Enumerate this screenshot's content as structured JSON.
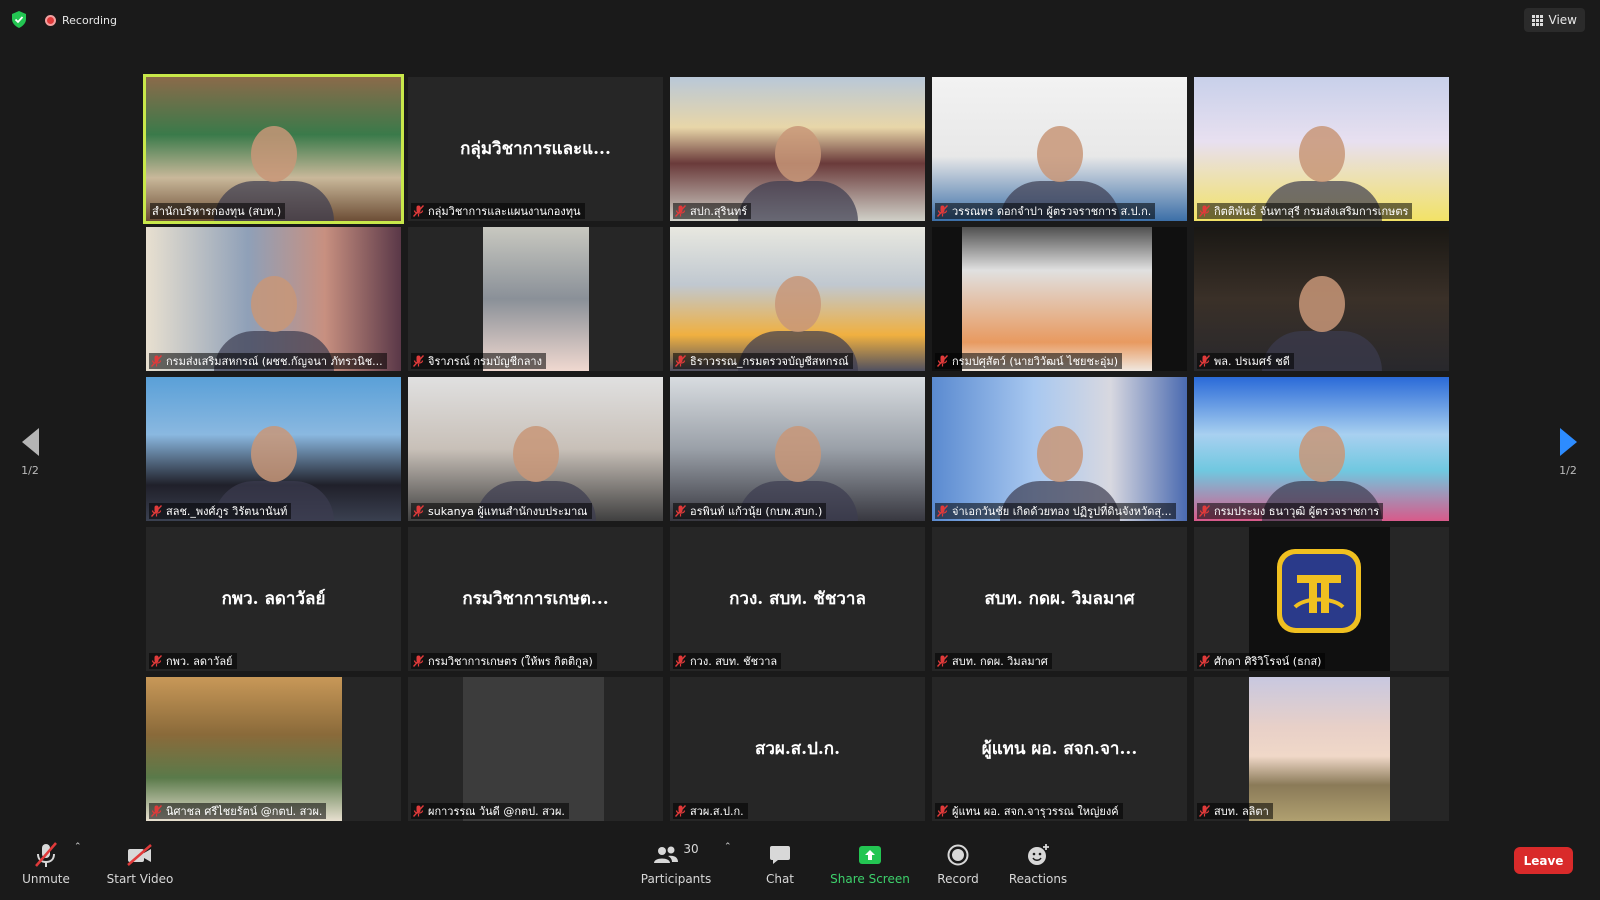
{
  "recording": {
    "label": "Recording"
  },
  "view_button": {
    "label": "View"
  },
  "pager": {
    "left_label": "1/2",
    "right_label": "1/2"
  },
  "tiles": [
    {
      "label": "สำนักบริหารกองทุน (สบท.)",
      "muted": false,
      "video": true,
      "center_name": ""
    },
    {
      "label": "กลุ่มวิชาการและแผนงานกองทุน",
      "muted": true,
      "video": false,
      "center_name": "กลุ่มวิชาการและแ..."
    },
    {
      "label": "สปก.สุรินทร์",
      "muted": true,
      "video": true,
      "center_name": ""
    },
    {
      "label": "วรรณพร ดอกจำปา ผู้ตรวจราชการ ส.ป.ก.",
      "muted": true,
      "video": true,
      "center_name": ""
    },
    {
      "label": "กิตติพันธ์ จันทาสุรี กรมส่งเสริมการเกษตร",
      "muted": true,
      "video": true,
      "center_name": ""
    },
    {
      "label": "กรมส่งเสริมสหกรณ์ (ผชช.กัญจนา ภัทรวนิช...",
      "muted": true,
      "video": true,
      "center_name": ""
    },
    {
      "label": "จิราภรณ์ กรมบัญชีกลาง",
      "muted": true,
      "video": true,
      "center_name": ""
    },
    {
      "label": "ธิราวรรณ_กรมตรวจบัญชีสหกรณ์",
      "muted": true,
      "video": true,
      "center_name": ""
    },
    {
      "label": "กรมปศุสัตว์ (นายวิวัฒน์ ไชยชะอุ่ม)",
      "muted": true,
      "video": true,
      "center_name": ""
    },
    {
      "label": "พล. ปรเมศร์ ชดี",
      "muted": true,
      "video": true,
      "center_name": ""
    },
    {
      "label": "สลช._พงศ์ภูร วิรัตนานันท์",
      "muted": true,
      "video": true,
      "center_name": ""
    },
    {
      "label": "sukanya ผู้แทนสำนักงบประมาณ",
      "muted": true,
      "video": true,
      "center_name": ""
    },
    {
      "label": "อรพินท์ แก้วนุ้ย (กบพ.สบก.)",
      "muted": true,
      "video": true,
      "center_name": ""
    },
    {
      "label": "จ่าเอกวันชัย เกิดด้วยทอง ปฏิรูปที่ดินจังหวัดสุ...",
      "muted": true,
      "video": true,
      "center_name": ""
    },
    {
      "label": "กรมประมง ธนาวุฒิ ผู้ตรวจราชการ",
      "muted": true,
      "video": true,
      "center_name": ""
    },
    {
      "label": "กพว. ลดาวัลย์",
      "muted": true,
      "video": false,
      "center_name": "กพว. ลดาวัลย์"
    },
    {
      "label": "กรมวิชาการเกษตร (ให้พร กิตติกูล)",
      "muted": true,
      "video": false,
      "center_name": "กรมวิชาการเกษต..."
    },
    {
      "label": "กวง. สบท. ชัชวาล",
      "muted": true,
      "video": false,
      "center_name": "กวง. สบท. ชัชวาล"
    },
    {
      "label": "สบท. กดผ. วิมลมาศ",
      "muted": true,
      "video": false,
      "center_name": "สบท. กดผ. วิมลมาศ"
    },
    {
      "label": "ศักดา ศิริวิโรจน์ (ธกส)",
      "muted": true,
      "video": true,
      "center_name": ""
    },
    {
      "label": "นิศาชล ศรีไชยรัตน์ @กตป. สวผ.",
      "muted": true,
      "video": true,
      "center_name": ""
    },
    {
      "label": "ผกาวรรณ วันดี @กตป. สวผ.",
      "muted": true,
      "video": true,
      "center_name": ""
    },
    {
      "label": "สวผ.ส.ป.ก.",
      "muted": true,
      "video": false,
      "center_name": "สวผ.ส.ป.ก."
    },
    {
      "label": "ผู้แทน ผอ. สจก.จารุวรรณ ใหญ่ยงค์",
      "muted": true,
      "video": false,
      "center_name": "ผู้แทน ผอ. สจก.จา..."
    },
    {
      "label": "สบท. ลลิตา",
      "muted": true,
      "video": true,
      "center_name": ""
    }
  ],
  "toolbar": {
    "unmute": "Unmute",
    "start_video": "Start Video",
    "participants_label": "Participants",
    "participants_count": "30",
    "chat": "Chat",
    "share_screen": "Share Screen",
    "record": "Record",
    "reactions": "Reactions",
    "leave": "Leave"
  },
  "colors": {
    "background": "#1a1a1a",
    "active_speaker_border": "#c8e84a",
    "leave_button": "#d92a2a",
    "share_green": "#3dd06b",
    "nav_arrow_blue": "#2d8cff",
    "muted_red": "#e03a3a"
  }
}
